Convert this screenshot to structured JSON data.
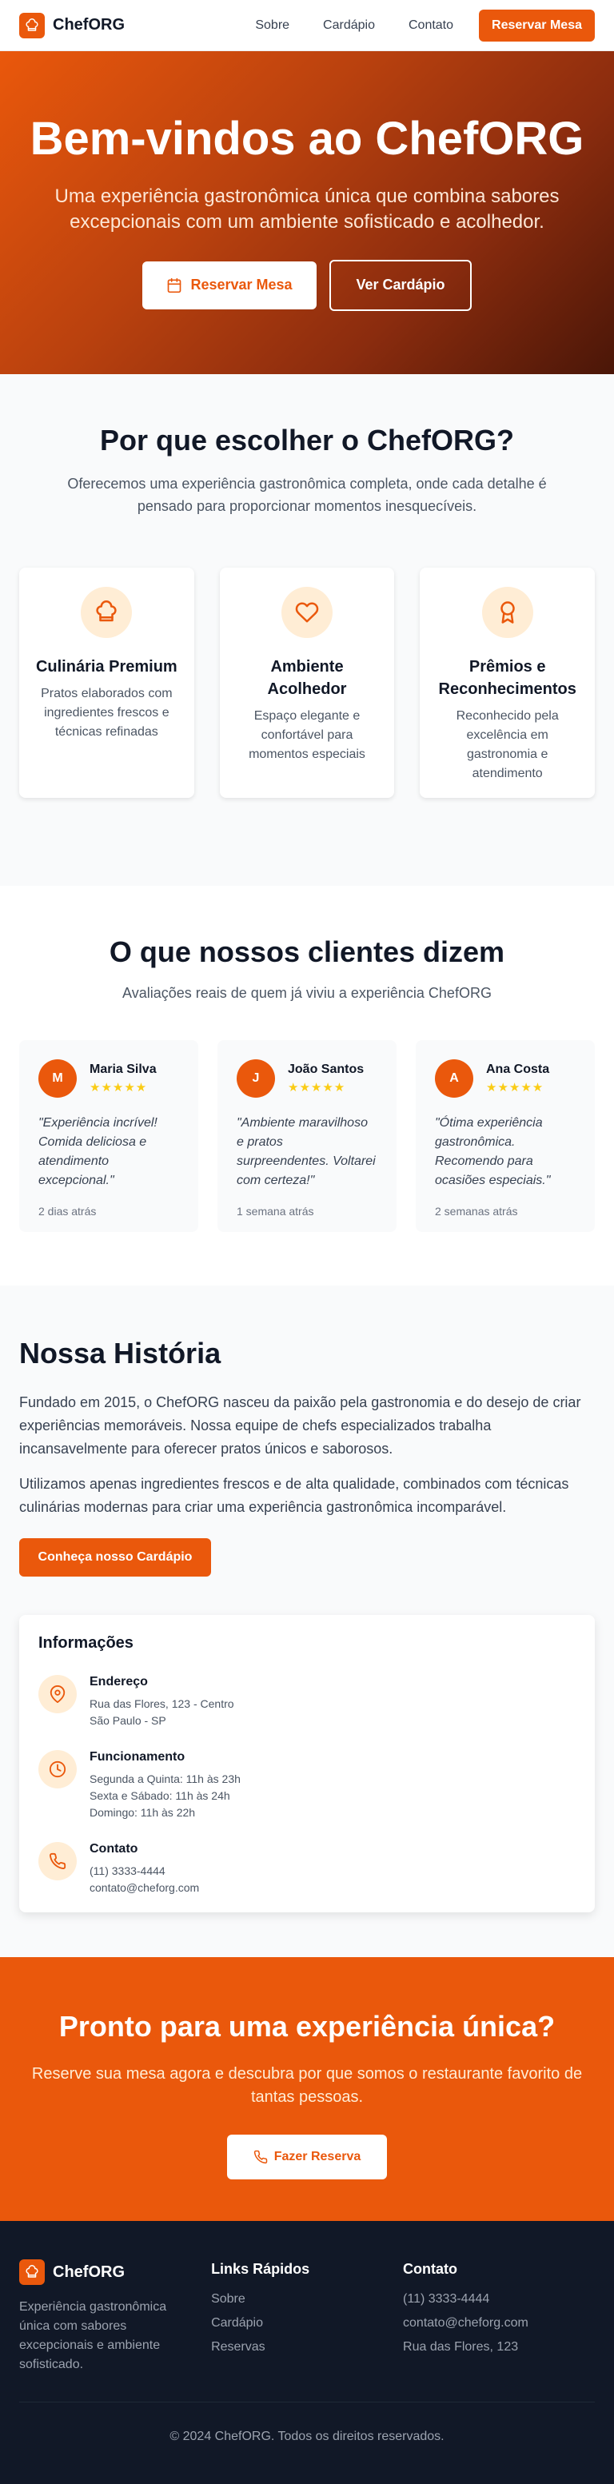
{
  "brand": {
    "name": "ChefORG",
    "accent": "#ea580c"
  },
  "nav": {
    "links": [
      "Sobre",
      "Cardápio",
      "Contato"
    ],
    "cta": "Reservar Mesa"
  },
  "hero": {
    "title": "Bem-vindos ao ChefORG",
    "subtitle": "Uma experiência gastronômica única que combina sabores excepcionais com um ambiente sofisticado e acolhedor.",
    "primary_button": "Reservar Mesa",
    "secondary_button": "Ver Cardápio"
  },
  "why": {
    "title": "Por que escolher o ChefORG?",
    "subtitle": "Oferecemos uma experiência gastronômica completa, onde cada detalhe é pensado para proporcionar momentos inesquecíveis.",
    "features": [
      {
        "icon": "chef-hat-icon",
        "title": "Culinária Premium",
        "text": "Pratos elaborados com ingredientes frescos e técnicas refinadas"
      },
      {
        "icon": "heart-icon",
        "title": "Ambiente Acolhedor",
        "text": "Espaço elegante e confortável para momentos especiais"
      },
      {
        "icon": "award-icon",
        "title": "Prêmios e Reconhecimentos",
        "text": "Reconhecido pela excelência em gastronomia e atendimento"
      }
    ]
  },
  "testimonials": {
    "title": "O que nossos clientes dizem",
    "subtitle": "Avaliações reais de quem já viviu a experiência ChefORG",
    "items": [
      {
        "initial": "M",
        "name": "Maria Silva",
        "stars": "★★★★★",
        "rating": 5,
        "quote": "\"Experiência incrível! Comida deliciosa e atendimento excepcional.\"",
        "time": "2 dias atrás"
      },
      {
        "initial": "J",
        "name": "João Santos",
        "stars": "★★★★★",
        "rating": 5,
        "quote": "\"Ambiente maravilhoso e pratos surpreendentes. Voltarei com certeza!\"",
        "time": "1 semana atrás"
      },
      {
        "initial": "A",
        "name": "Ana Costa",
        "stars": "★★★★★",
        "rating": 5,
        "quote": "\"Ótima experiência gastronômica. Recomendo para ocasiões especiais.\"",
        "time": "2 semanas atrás"
      }
    ]
  },
  "story": {
    "title": "Nossa História",
    "paragraphs": [
      "Fundado em 2015, o ChefORG nasceu da paixão pela gastronomia e do desejo de criar experiências memoráveis. Nossa equipe de chefs especializados trabalha incansavelmente para oferecer pratos únicos e saborosos.",
      "Utilizamos apenas ingredientes frescos e de alta qualidade, combinados com técnicas culinárias modernas para criar uma experiência gastronômica incomparável."
    ],
    "button": "Conheça nosso Cardápio"
  },
  "info": {
    "title": "Informações",
    "items": [
      {
        "icon": "map-pin-icon",
        "title": "Endereço",
        "lines": [
          "Rua das Flores, 123 - Centro",
          "São Paulo - SP"
        ]
      },
      {
        "icon": "clock-icon",
        "title": "Funcionamento",
        "lines": [
          "Segunda a Quinta: 11h às 23h",
          "Sexta e Sábado: 11h às 24h",
          "Domingo: 11h às 22h"
        ]
      },
      {
        "icon": "phone-icon",
        "title": "Contato",
        "lines": [
          "(11) 3333-4444",
          "contato@cheforg.com"
        ]
      }
    ]
  },
  "cta": {
    "title": "Pronto para uma experiência única?",
    "subtitle": "Reserve sua mesa agora e descubra por que somos o restaurante favorito de tantas pessoas.",
    "button": "Fazer Reserva"
  },
  "footer": {
    "brand_desc": "Experiência gastronômica única com sabores excepcionais e ambiente sofisticado.",
    "quick_links_title": "Links Rápidos",
    "quick_links": [
      "Sobre",
      "Cardápio",
      "Reservas"
    ],
    "contact_title": "Contato",
    "contact_lines": [
      "(11) 3333-4444",
      "contato@cheforg.com",
      "Rua das Flores, 123"
    ],
    "copyright": "© 2024 ChefORG. Todos os direitos reservados."
  }
}
